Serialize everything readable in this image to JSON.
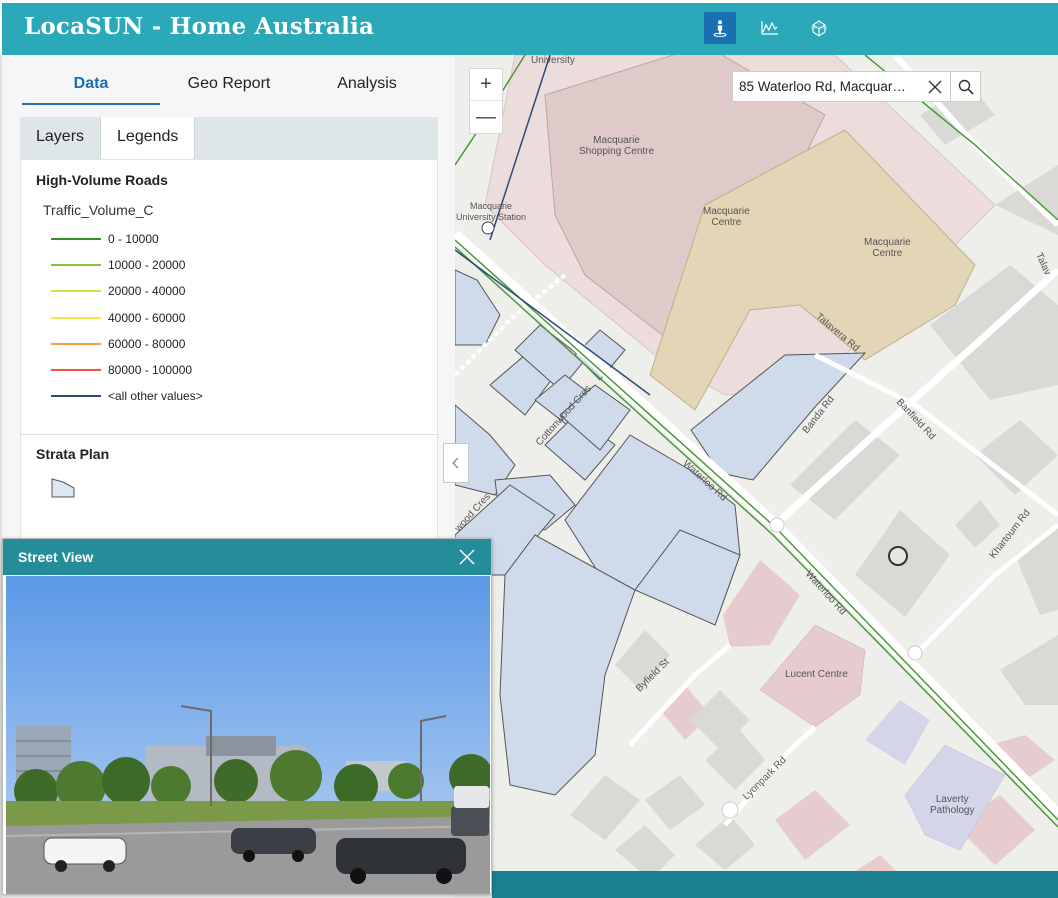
{
  "header": {
    "title": "LocaSUN - Home Australia",
    "buttons": [
      {
        "icon": "street-view-person-icon",
        "active": true
      },
      {
        "icon": "elevation-profile-icon",
        "active": false
      },
      {
        "icon": "3d-cube-icon",
        "active": false
      }
    ]
  },
  "main_tabs": [
    {
      "label": "Data",
      "active": true
    },
    {
      "label": "Geo Report",
      "active": false
    },
    {
      "label": "Analysis",
      "active": false
    }
  ],
  "sub_tabs": [
    {
      "label": "Layers",
      "active": false
    },
    {
      "label": "Legends",
      "active": true
    }
  ],
  "legend": {
    "layer1_title": "High-Volume Roads",
    "field": "Traffic_Volume_C",
    "items": [
      {
        "label": "0 - 10000",
        "color": "#3a8a2e"
      },
      {
        "label": "10000 - 20000",
        "color": "#8cbf3f"
      },
      {
        "label": "20000 - 40000",
        "color": "#d6e24a"
      },
      {
        "label": "40000 - 60000",
        "color": "#f7e44b"
      },
      {
        "label": "60000 - 80000",
        "color": "#f5a03f"
      },
      {
        "label": "80000 - 100000",
        "color": "#e8553c"
      },
      {
        "label": "<all other values>",
        "color": "#2e4a7a"
      }
    ],
    "layer2_title": "Strata Plan",
    "strata_color": "#dde7f4"
  },
  "street_view": {
    "title": "Street View"
  },
  "map": {
    "search_value": "85 Waterloo Rd, Macquar…",
    "zoom_in": "+",
    "zoom_out": "—",
    "labels": {
      "university": "University",
      "macquarie_shopping": "Macquarie\nShopping Centre",
      "macquarie_centre_1": "Macquarie\nCentre",
      "macquarie_centre_2": "Macquarie\nCentre",
      "macquarie_station": "Macquarie\nUniversity Station",
      "lucent_centre": "Lucent Centre",
      "laverty_pathology": "Laverty\nPathology"
    },
    "roads": {
      "talavera": "Talavera Rd",
      "banda": "Banda Rd",
      "banfield": "Banfield Rd",
      "waterloo_1": "Waterloo Rd",
      "waterloo_2": "Waterloo Rd",
      "cottonwood": "Cottonwood Cres",
      "wood_cres": "wood Cres",
      "byfield": "Byfield St",
      "lyonpark": "Lyonpark Rd",
      "khartoum": "Khartoum Rd",
      "talav_right": "Talav"
    }
  },
  "colors": {
    "header": "#2ba9b8",
    "active_tab": "#1d6db3",
    "street_view_header": "#258d99"
  }
}
